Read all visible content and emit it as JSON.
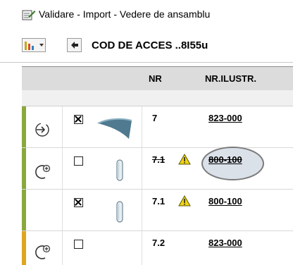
{
  "window": {
    "title": "Validare - Import - Vedere de ansamblu",
    "access_code": "COD DE ACCES ..8I55u"
  },
  "table": {
    "headers": {
      "nr": "NR",
      "nr_ilustr": "NR.ILUSTR."
    },
    "rows": [
      {
        "status_icon": "import-arrow-icon",
        "bar_color": "#8aa83c",
        "checked": true,
        "part_image": "curved-panel",
        "nr": "7",
        "warning": false,
        "nr_ilustr": "823-000",
        "strikethrough": false
      },
      {
        "status_icon": "add-part-icon",
        "bar_color": "#8aa83c",
        "checked": false,
        "part_image": "small-pin",
        "nr": "7.1",
        "warning": true,
        "nr_ilustr": "800-100",
        "strikethrough": true,
        "highlighted": true
      },
      {
        "status_icon": "",
        "bar_color": "#8aa83c",
        "checked": true,
        "part_image": "small-pin",
        "nr": "7.1",
        "warning": true,
        "nr_ilustr": "800-100",
        "strikethrough": false
      },
      {
        "status_icon": "add-part-icon",
        "bar_color": "#e0a51f",
        "checked": false,
        "part_image": "",
        "nr": "7.2",
        "warning": false,
        "nr_ilustr": "823-000",
        "strikethrough": false
      }
    ]
  },
  "colors": {
    "ok_bar": "#8aa83c",
    "warn_bar": "#e0a51f",
    "warning_icon": "#f2d312"
  }
}
